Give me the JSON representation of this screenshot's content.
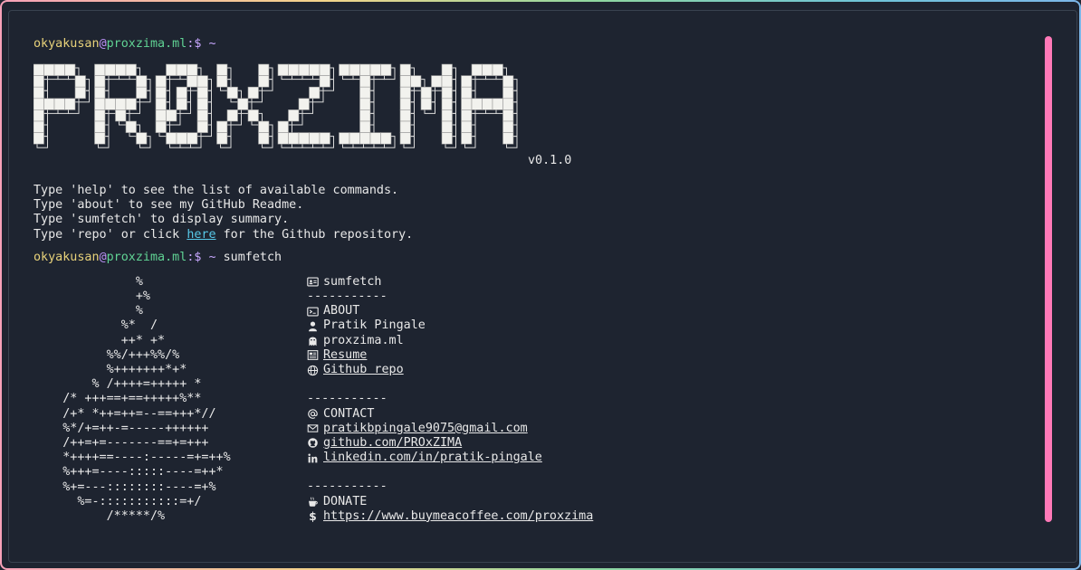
{
  "prompt": {
    "user": "okyakusan",
    "at": "@",
    "host": "proxzima.ml",
    "sep": ":$ ~"
  },
  "first_command": "",
  "second_command": "sumfetch",
  "logo": {
    "text": "PROXZIMA",
    "version": "v0.1.0"
  },
  "help": {
    "line1": "Type 'help' to see the list of available commands.",
    "line2": "Type 'about' to see my GitHub Readme.",
    "line3": "Type 'sumfetch' to display summary.",
    "line4_pre": "Type 'repo' or click ",
    "line4_link": "here",
    "line4_post": " for the Github repository."
  },
  "ascii_art": "              %\n              +%\n              %\n            %*  /\n            ++* +*\n          %%/+++%%/%\n          %+++++++*+*\n        % /++++=+++++ *\n    /* +++==+==+++++%**\n    /+* *++=++=--==+++*//\n    %*/+=++-=-----++++++\n    /++=+=-------==+=+++\n    *++++==----:-----=+=++%\n    %+++=----:::::----=++*\n    %+=---::::::::----=+%\n      %=-:::::::::::=+/\n          /*****/%",
  "info": {
    "title": "sumfetch",
    "divider": "-----------",
    "about_header": "ABOUT",
    "name": "Pratik Pingale",
    "site": "proxzima.ml",
    "resume": "Resume",
    "github_repo": "Github repo",
    "contact_header": "CONTACT",
    "email": "pratikbpingale9075@gmail.com",
    "github": "github.com/PROxZIMA",
    "linkedin": "linkedin.com/in/pratik-pingale",
    "donate_header": "DONATE",
    "donate_url": "https://www.buymeacoffee.com/proxzima"
  },
  "colors": {
    "background": "#1e2430",
    "user": "#e8d27a",
    "host": "#60d394",
    "at": "#bd93f9",
    "link": "#58c8e8",
    "scrollbar": "#ff79b8"
  }
}
